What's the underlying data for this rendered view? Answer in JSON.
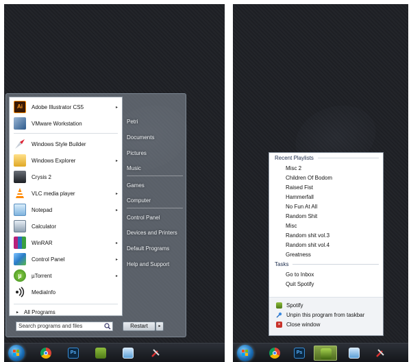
{
  "start_menu": {
    "programs": [
      {
        "label": "Adobe Illustrator CS5",
        "icon": "illustrator-icon",
        "has_submenu": true
      },
      {
        "label": "VMware Workstation",
        "icon": "vmware-icon",
        "has_submenu": false
      },
      {
        "label": "Windows Style Builder",
        "icon": "style-builder-icon",
        "has_submenu": false
      },
      {
        "label": "Windows Explorer",
        "icon": "folder-icon",
        "has_submenu": true
      },
      {
        "label": "Crysis 2",
        "icon": "crysis-icon",
        "has_submenu": false
      },
      {
        "label": "VLC media player",
        "icon": "vlc-icon",
        "has_submenu": true
      },
      {
        "label": "Notepad",
        "icon": "notepad-icon",
        "has_submenu": true
      },
      {
        "label": "Calculator",
        "icon": "calculator-icon",
        "has_submenu": false
      },
      {
        "label": "WinRAR",
        "icon": "winrar-icon",
        "has_submenu": true
      },
      {
        "label": "Control Panel",
        "icon": "control-panel-icon",
        "has_submenu": true
      },
      {
        "label": "µTorrent",
        "icon": "utorrent-icon",
        "has_submenu": true
      },
      {
        "label": "MediaInfo",
        "icon": "mediainfo-icon",
        "has_submenu": false
      }
    ],
    "all_programs_label": "All Programs",
    "search_placeholder": "Search programs and files",
    "restart_label": "Restart",
    "right_links": [
      "Petri",
      "Documents",
      "Pictures",
      "Music",
      "Games",
      "Computer",
      "Control Panel",
      "Devices and Printers",
      "Default Programs",
      "Help and Support"
    ]
  },
  "jump_list": {
    "recent_header": "Recent Playlists",
    "playlists": [
      "Misc 2",
      "Children Of Bodom",
      "Raised Fist",
      "Hammerfall",
      "No Fun At All",
      "Random Shit",
      "Misc",
      "Random shit vol.3",
      "Random shit vol.4",
      "Greatness"
    ],
    "tasks_header": "Tasks",
    "tasks": [
      "Go to Inbox",
      "Quit Spotify"
    ],
    "bottom": [
      {
        "label": "Spotify",
        "icon": "spotify-icon"
      },
      {
        "label": "Unpin this program from taskbar",
        "icon": "unpin-icon"
      },
      {
        "label": "Close window",
        "icon": "close-window-icon"
      }
    ]
  },
  "taskbar_apps": [
    "chrome-icon",
    "photoshop-icon",
    "spotify-icon",
    "remote-desktop-icon",
    "tools-icon"
  ],
  "colors": {
    "spotify_green": "#6c9a2c",
    "windows_blue": "#1b6fb8"
  }
}
